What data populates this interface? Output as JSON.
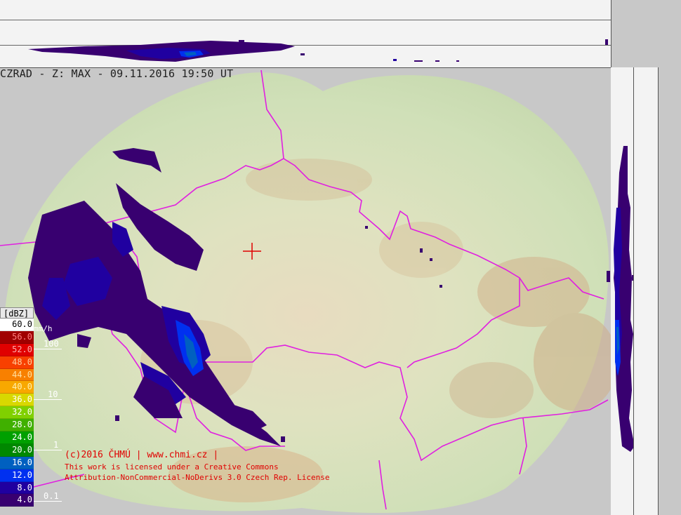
{
  "title": "CZRAD - Z: MAX - 09.11.2016 19:50 UT",
  "legend": {
    "unit": "[dBZ]",
    "rain_unit": "mm/h",
    "levels": [
      {
        "label": "60.0",
        "color": "#ffffff",
        "text": "#000000"
      },
      {
        "label": "56.0",
        "color": "#a00000",
        "text": "#ff8080"
      },
      {
        "label": "52.0",
        "color": "#e00000",
        "text": "#ffb0b0"
      },
      {
        "label": "48.0",
        "color": "#f84000",
        "text": "#ffd0a0"
      },
      {
        "label": "44.0",
        "color": "#f88000",
        "text": "#ffe0a0"
      },
      {
        "label": "40.0",
        "color": "#f8a800",
        "text": "#fff0b0"
      },
      {
        "label": "36.0",
        "color": "#d8d800",
        "text": "#ffffff"
      },
      {
        "label": "32.0",
        "color": "#80d000",
        "text": "#ffffff"
      },
      {
        "label": "28.0",
        "color": "#40b000",
        "text": "#ffffff"
      },
      {
        "label": "24.0",
        "color": "#00a000",
        "text": "#ffffff"
      },
      {
        "label": "20.0",
        "color": "#008800",
        "text": "#ffffff"
      },
      {
        "label": "16.0",
        "color": "#0060c0",
        "text": "#ffffff"
      },
      {
        "label": "12.0",
        "color": "#0030f0",
        "text": "#ffffff"
      },
      {
        "label": "8.0",
        "color": "#2000a0",
        "text": "#ffffff"
      },
      {
        "label": "4.0",
        "color": "#380070",
        "text": "#ffffff"
      }
    ],
    "rain_labels": [
      "100",
      "10",
      "1",
      "0.1"
    ]
  },
  "copyright": {
    "line1": "(c)2016 ČHMÚ | www.chmi.cz |",
    "line2": "This work is licensed under a Creative Commons",
    "line3": "Attribution-NonCommercial-NoDerivs 3.0 Czech Rep. License"
  },
  "colors": {
    "border": "#e020e0",
    "marker": "#e00000",
    "echo_weak": "#380070",
    "echo_mid": "#2000a0",
    "echo_strong": "#0030f0",
    "echo_stronger": "#0060c0"
  }
}
